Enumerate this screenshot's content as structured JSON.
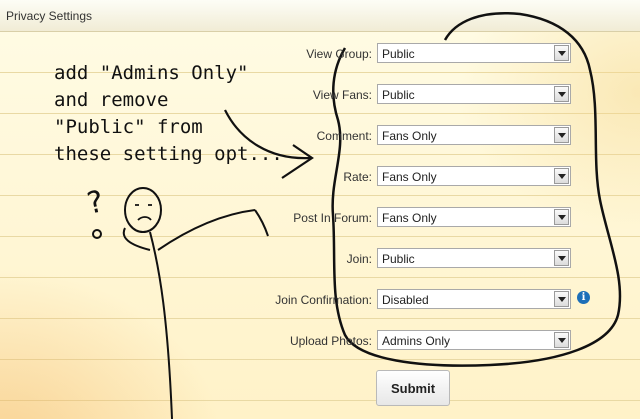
{
  "header": {
    "title": "Privacy Settings"
  },
  "annotation": {
    "text": "add \"Admins Only\"\nand remove\n\"Public\" from\nthese setting opt..."
  },
  "form": {
    "fields": [
      {
        "label": "View Group:",
        "value": "Public"
      },
      {
        "label": "View Fans:",
        "value": "Public"
      },
      {
        "label": "Comment:",
        "value": "Fans Only"
      },
      {
        "label": "Rate:",
        "value": "Fans Only"
      },
      {
        "label": "Post In Forum:",
        "value": "Fans Only"
      },
      {
        "label": "Join:",
        "value": "Public"
      },
      {
        "label": "Join Confirmation:",
        "value": "Disabled",
        "info_icon": "info-icon"
      },
      {
        "label": "Upload Photos:",
        "value": "Admins Only"
      }
    ],
    "submit_label": "Submit"
  },
  "colors": {
    "info_icon": "#1d6fb8",
    "background": "#fff7d2"
  }
}
